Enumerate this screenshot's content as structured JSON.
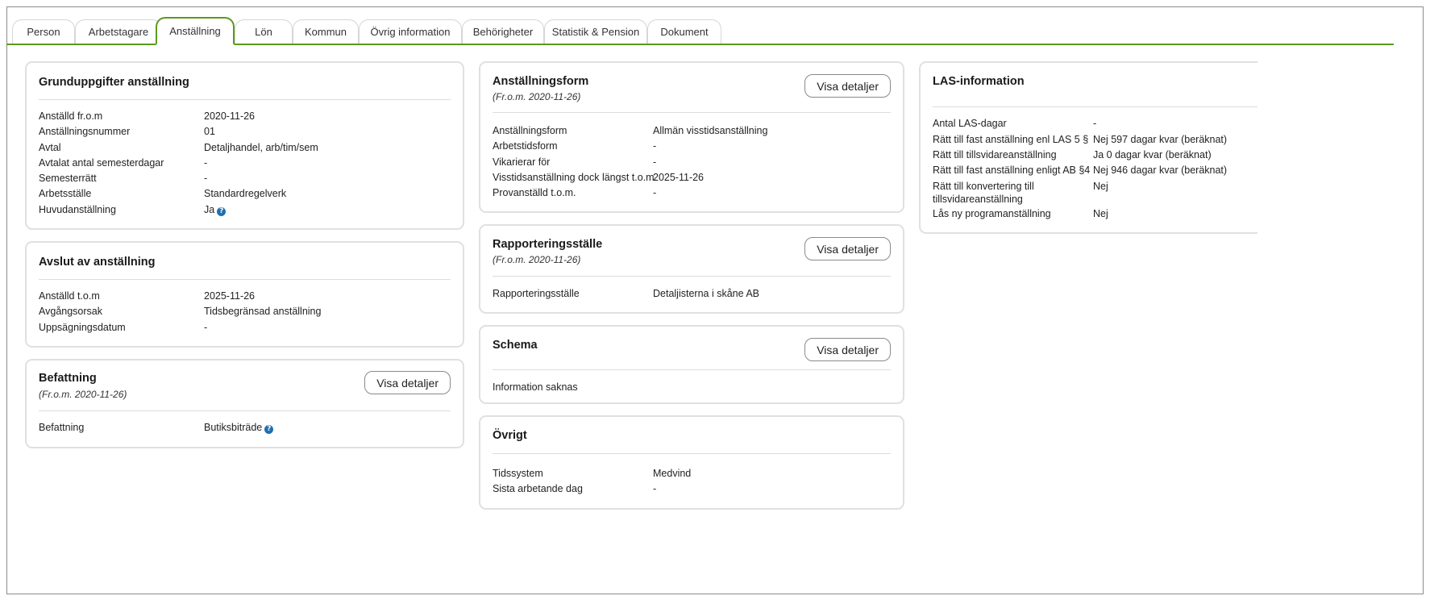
{
  "tabs": [
    {
      "label": "Person"
    },
    {
      "label": "Arbetstagare"
    },
    {
      "label": "Anställning"
    },
    {
      "label": "Lön"
    },
    {
      "label": "Kommun"
    },
    {
      "label": "Övrig information"
    },
    {
      "label": "Behörigheter"
    },
    {
      "label": "Statistik & Pension"
    },
    {
      "label": "Dokument"
    }
  ],
  "active_tab": "Anställning",
  "colors": {
    "accent": "#5b9a1e",
    "help_icon": "#1f6fb2"
  },
  "visa_detaljer_label": "Visa detaljer",
  "grunduppgifter": {
    "title": "Grunduppgifter anställning",
    "rows": [
      {
        "label": "Anställd fr.o.m",
        "value": "2020-11-26"
      },
      {
        "label": "Anställningsnummer",
        "value": "01"
      },
      {
        "label": "Avtal",
        "value": "Detaljhandel, arb/tim/sem"
      },
      {
        "label": "Avtalat antal semesterdagar",
        "value": "-"
      },
      {
        "label": "Semesterrätt",
        "value": "-"
      },
      {
        "label": "Arbetsställe",
        "value": "Standardregelverk"
      },
      {
        "label": "Huvudanställning",
        "value": "Ja"
      }
    ]
  },
  "avslut": {
    "title": "Avslut av anställning",
    "rows": [
      {
        "label": "Anställd t.o.m",
        "value": "2025-11-26"
      },
      {
        "label": "Avgångsorsak",
        "value": "Tidsbegränsad anställning"
      },
      {
        "label": "Uppsägningsdatum",
        "value": "-"
      }
    ]
  },
  "befattning": {
    "title": "Befattning",
    "subtitle": "(Fr.o.m. 2020-11-26)",
    "rows": [
      {
        "label": "Befattning",
        "value": "Butiksbiträde"
      }
    ]
  },
  "anstallningsform": {
    "title": "Anställningsform",
    "subtitle": "(Fr.o.m. 2020-11-26)",
    "rows": [
      {
        "label": "Anställningsform",
        "value": "Allmän visstidsanställning"
      },
      {
        "label": "Arbetstidsform",
        "value": "-"
      },
      {
        "label": "Vikarierar för",
        "value": "-"
      },
      {
        "label": "Visstidsanställning dock längst t.o.m.",
        "value": "2025-11-26"
      },
      {
        "label": "Provanställd t.o.m.",
        "value": "-"
      }
    ]
  },
  "rapportering": {
    "title": "Rapporteringsställe",
    "subtitle": "(Fr.o.m. 2020-11-26)",
    "rows": [
      {
        "label": "Rapporteringsställe",
        "value": "Detaljisterna i skåne AB"
      }
    ]
  },
  "schema": {
    "title": "Schema",
    "info": "Information saknas"
  },
  "ovrigt": {
    "title": "Övrigt",
    "rows": [
      {
        "label": "Tidssystem",
        "value": "Medvind"
      },
      {
        "label": "Sista arbetande dag",
        "value": "-"
      }
    ]
  },
  "las": {
    "title": "LAS-information",
    "rows": [
      {
        "label": "Antal LAS-dagar",
        "value": "-"
      },
      {
        "label": "Rätt till fast anställning enl LAS 5 §",
        "value": "Nej 597 dagar kvar (beräknat)"
      },
      {
        "label": "Rätt till tillsvidareanställning",
        "value": "Ja 0 dagar kvar (beräknat)"
      },
      {
        "label": "Rätt till fast anställning enligt AB §4",
        "value": "Nej 946 dagar kvar (beräknat)"
      },
      {
        "label": "Rätt till konvertering till tillsvidareanställning",
        "value": "Nej"
      },
      {
        "label": "Lås ny programanställning",
        "value": "Nej"
      }
    ]
  }
}
